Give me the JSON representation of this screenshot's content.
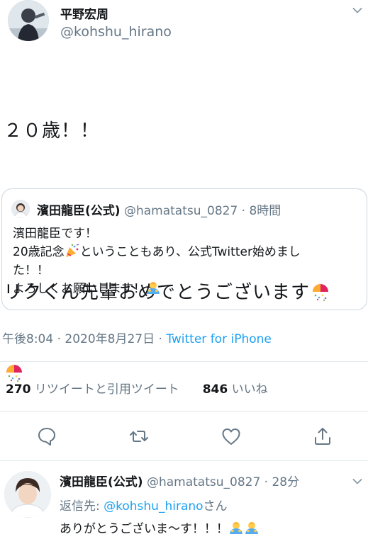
{
  "tweet": {
    "author_name": "平野宏周",
    "author_handle": "@kohshu_hirano",
    "text_line1": "２０歳！！",
    "text_line2": "",
    "text_line3": "リクくん先輩おめでとうございます",
    "timestamp": "午後8:04 · 2020年8月27日 · ",
    "source": "Twitter for iPhone",
    "retweet_count": "270",
    "retweet_label": "リツイートと引用ツイート",
    "like_count": "846",
    "like_label": "いいね"
  },
  "quote": {
    "name": "濱田龍臣(公式)",
    "meta": " @hamatatsu_0827 · 8時間",
    "line1": "濱田龍臣です！",
    "line2a": "20歳記念",
    "line2b": "ということもあり、公式Twitter始めまし",
    "line3": "た！！",
    "line4": "よろしくお願いします！"
  },
  "reply": {
    "name": "濱田龍臣(公式)",
    "meta": " @hamatatsu_0827 · 28分",
    "to_prefix": "返信先: ",
    "to_mention": "@kohshu_hirano",
    "to_suffix": "さん",
    "text": "ありがとうございま〜す！！！"
  },
  "icons": {
    "menu": "chevron-down-icon",
    "reply": "comment-icon",
    "retweet": "retweet-icon",
    "like": "heart-icon",
    "share": "share-icon"
  },
  "colors": {
    "accent": "#1da1f2",
    "muted": "#657786",
    "border": "#e1e8ed"
  }
}
